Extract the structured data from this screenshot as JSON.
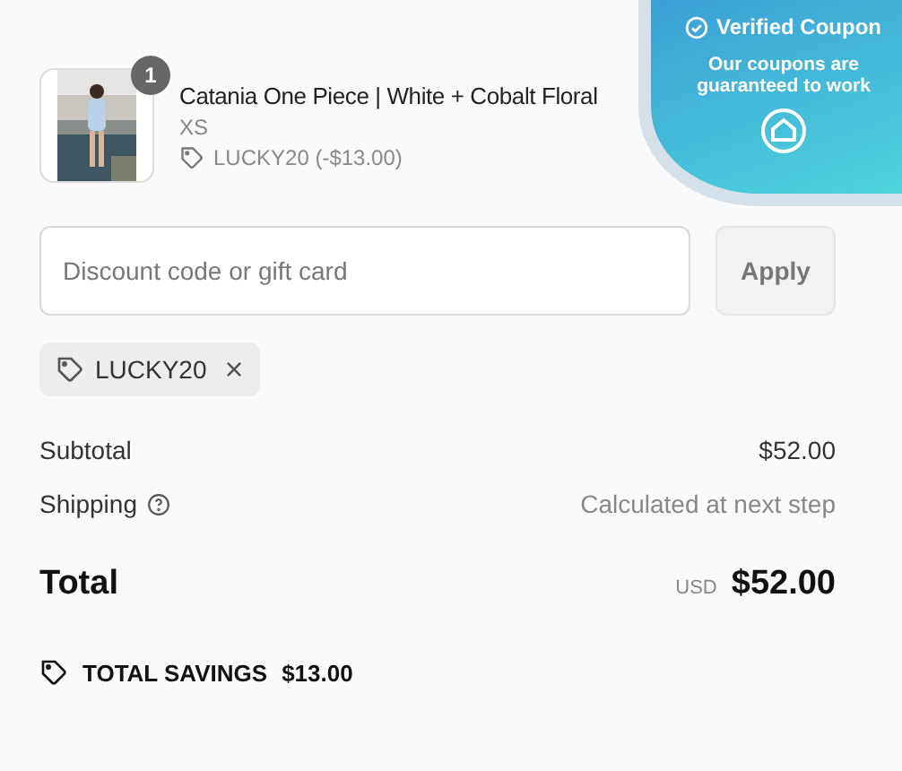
{
  "product": {
    "quantity": "1",
    "title": "Catania One Piece | White + Cobalt Floral",
    "variant": "XS",
    "discount": "LUCKY20 (-$13.00)"
  },
  "discount_form": {
    "placeholder": "Discount code or gift card",
    "button": "Apply"
  },
  "applied_code": {
    "code": "LUCKY20",
    "remove": "×"
  },
  "summary": [
    {
      "label": "Subtotal",
      "value": "$52.00",
      "help": false
    },
    {
      "label": "Shipping",
      "value": "Calculated at next step",
      "help": true
    }
  ],
  "total": {
    "label": "Total",
    "currency": "USD",
    "value": "$52.00"
  },
  "savings": {
    "label": "TOTAL SAVINGS",
    "value": "$13.00"
  },
  "popup": {
    "title": "Verified Coupon",
    "message": "Our coupons are guaranteed to work"
  }
}
